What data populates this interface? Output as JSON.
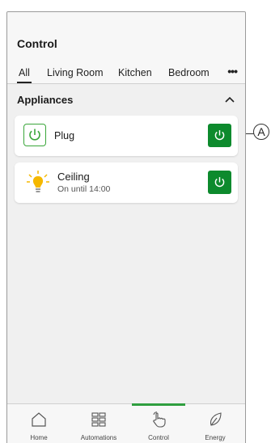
{
  "header": {
    "title": "Control",
    "tabs": [
      {
        "label": "All",
        "active": true
      },
      {
        "label": "Living Room",
        "active": false
      },
      {
        "label": "Kitchen",
        "active": false
      },
      {
        "label": "Bedroom",
        "active": false
      }
    ],
    "more_icon": "more-horizontal-icon",
    "more_label": "•••"
  },
  "section": {
    "title": "Appliances",
    "toggle_icon": "chevron-up-icon"
  },
  "devices": [
    {
      "name": "Plug",
      "icon": "power-outline-icon",
      "status": "",
      "power_on": true
    },
    {
      "name": "Ceiling",
      "icon": "lightbulb-on-icon",
      "status": "On until 14:00",
      "power_on": true
    }
  ],
  "bottom_nav": [
    {
      "label": "Home",
      "icon": "home-icon",
      "active": false
    },
    {
      "label": "Automations",
      "icon": "grid-icon",
      "active": false
    },
    {
      "label": "Control",
      "icon": "hand-pointer-icon",
      "active": true
    },
    {
      "label": "Energy",
      "icon": "leaf-icon",
      "active": false
    }
  ],
  "callout": {
    "label": "A"
  },
  "colors": {
    "accent_green": "#0d8a2d",
    "active_nav": "#2f9e3f",
    "bulb_yellow": "#f5b800",
    "background": "#f0f0f0"
  }
}
